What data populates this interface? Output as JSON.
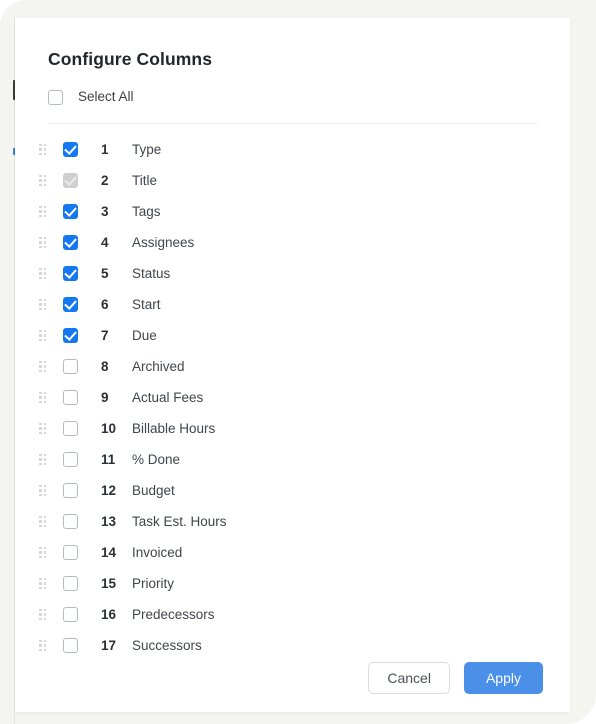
{
  "dialog": {
    "title": "Configure Columns",
    "select_all": {
      "label": "Select All",
      "checked": false
    },
    "columns": [
      {
        "index": "1",
        "label": "Type",
        "state": "checked"
      },
      {
        "index": "2",
        "label": "Title",
        "state": "disabled"
      },
      {
        "index": "3",
        "label": "Tags",
        "state": "checked"
      },
      {
        "index": "4",
        "label": "Assignees",
        "state": "checked"
      },
      {
        "index": "5",
        "label": "Status",
        "state": "checked"
      },
      {
        "index": "6",
        "label": "Start",
        "state": "checked"
      },
      {
        "index": "7",
        "label": "Due",
        "state": "checked"
      },
      {
        "index": "8",
        "label": "Archived",
        "state": "unchecked"
      },
      {
        "index": "9",
        "label": "Actual Fees",
        "state": "unchecked"
      },
      {
        "index": "10",
        "label": "Billable Hours",
        "state": "unchecked"
      },
      {
        "index": "11",
        "label": "% Done",
        "state": "unchecked"
      },
      {
        "index": "12",
        "label": "Budget",
        "state": "unchecked"
      },
      {
        "index": "13",
        "label": "Task Est. Hours",
        "state": "unchecked"
      },
      {
        "index": "14",
        "label": "Invoiced",
        "state": "unchecked"
      },
      {
        "index": "15",
        "label": "Priority",
        "state": "unchecked"
      },
      {
        "index": "16",
        "label": "Predecessors",
        "state": "unchecked"
      },
      {
        "index": "17",
        "label": "Successors",
        "state": "unchecked"
      }
    ],
    "footer": {
      "cancel_label": "Cancel",
      "apply_label": "Apply"
    }
  },
  "theme": {
    "accent_blue": "#1479f0",
    "apply_button_blue": "#4a90e8",
    "backdrop": "#f4f4f1",
    "card": "#ffffff",
    "divider": "#e9e9e7",
    "disabled_grey": "#cfcfcf"
  }
}
